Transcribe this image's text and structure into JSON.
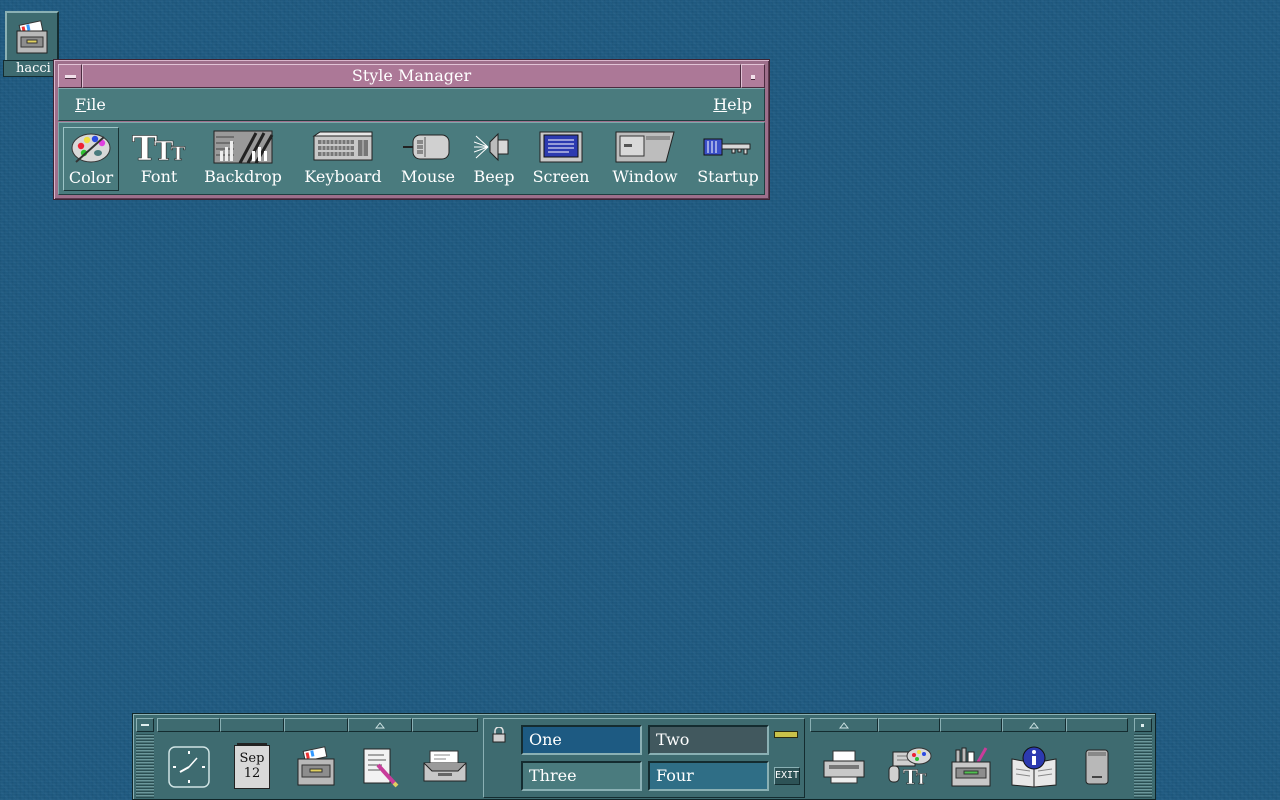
{
  "desktop": {
    "icon_label": "hacci",
    "colors": {
      "background": "#1d5a82"
    }
  },
  "style_manager": {
    "title": "Style Manager",
    "menu": {
      "file": {
        "mnemonic": "F",
        "rest": "ile"
      },
      "help": {
        "mnemonic": "H",
        "rest": "elp"
      }
    },
    "tools": [
      {
        "label": "Color",
        "icon": "palette-icon",
        "selected": true
      },
      {
        "label": "Font",
        "icon": "font-icon"
      },
      {
        "label": "Backdrop",
        "icon": "backdrop-icon"
      },
      {
        "label": "Keyboard",
        "icon": "keyboard-icon"
      },
      {
        "label": "Mouse",
        "icon": "mouse-icon"
      },
      {
        "label": "Beep",
        "icon": "speaker-icon"
      },
      {
        "label": "Screen",
        "icon": "monitor-icon"
      },
      {
        "label": "Window",
        "icon": "window-icon"
      },
      {
        "label": "Startup",
        "icon": "key-icon"
      }
    ],
    "colors": {
      "frame": "#9e6f8b",
      "body": "#4a7b7e"
    }
  },
  "front_panel": {
    "calendar": {
      "month": "Sep",
      "day": "12"
    },
    "workspaces": [
      {
        "label": "One",
        "active": true
      },
      {
        "label": "Two",
        "active": false
      },
      {
        "label": "Three",
        "active": false
      },
      {
        "label": "Four",
        "active": false
      }
    ],
    "exit_label": "EXIT",
    "colors": {
      "panel": "#3e6b70",
      "ws_one": "#1d5a82",
      "ws_two": "#41585e",
      "ws_three": "#4a7b7e",
      "ws_four": "#2f6e86"
    }
  }
}
